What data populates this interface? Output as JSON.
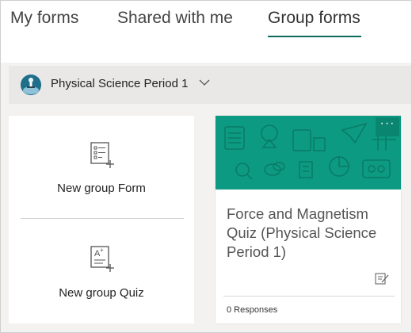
{
  "tabs": [
    {
      "label": "My forms"
    },
    {
      "label": "Shared with me"
    },
    {
      "label": "Group forms",
      "selected": true
    }
  ],
  "group": {
    "name": "Physical Science Period 1",
    "icon": "group-avatar-icon",
    "chevron": "chevron-down-icon"
  },
  "new_actions": {
    "form_label": "New group Form",
    "form_icon": "new-form-icon",
    "quiz_label": "New group Quiz",
    "quiz_icon": "new-quiz-icon"
  },
  "form_card": {
    "title": "Force and Magnetism Quiz (Physical Science Period 1)",
    "more_label": "···",
    "responses": "0 Responses",
    "banner_color": "#0d9a82",
    "edit_icon": "edit-icon"
  },
  "colors": {
    "accent": "#0b6a5c",
    "background": "#f3f2f1"
  }
}
